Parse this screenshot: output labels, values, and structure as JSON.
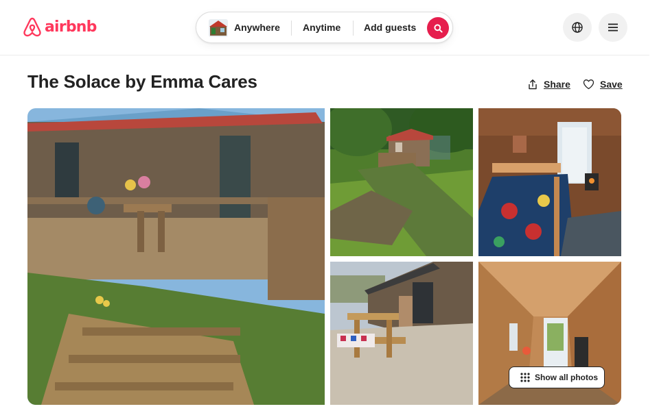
{
  "brand": {
    "name": "airbnb",
    "color": "#FF385C"
  },
  "search": {
    "location_label": "Anywhere",
    "dates_label": "Anytime",
    "guests_label": "Add guests",
    "button_color": "#E61E4D",
    "button_icon": "search-icon"
  },
  "header_actions": {
    "language_icon": "globe-icon",
    "menu_icon": "hamburger-menu-icon"
  },
  "listing": {
    "title": "The Solace by Emma Cares",
    "share_label": "Share",
    "save_label": "Save"
  },
  "gallery": {
    "photos": [
      {
        "subject": "wooden-cabin-deck-photo"
      },
      {
        "subject": "cabin-on-hillside-photo"
      },
      {
        "subject": "cabin-bedroom-photo"
      },
      {
        "subject": "picnic-bench-patio-photo"
      },
      {
        "subject": "cabin-interior-photo"
      }
    ],
    "show_all_label": "Show all photos"
  }
}
